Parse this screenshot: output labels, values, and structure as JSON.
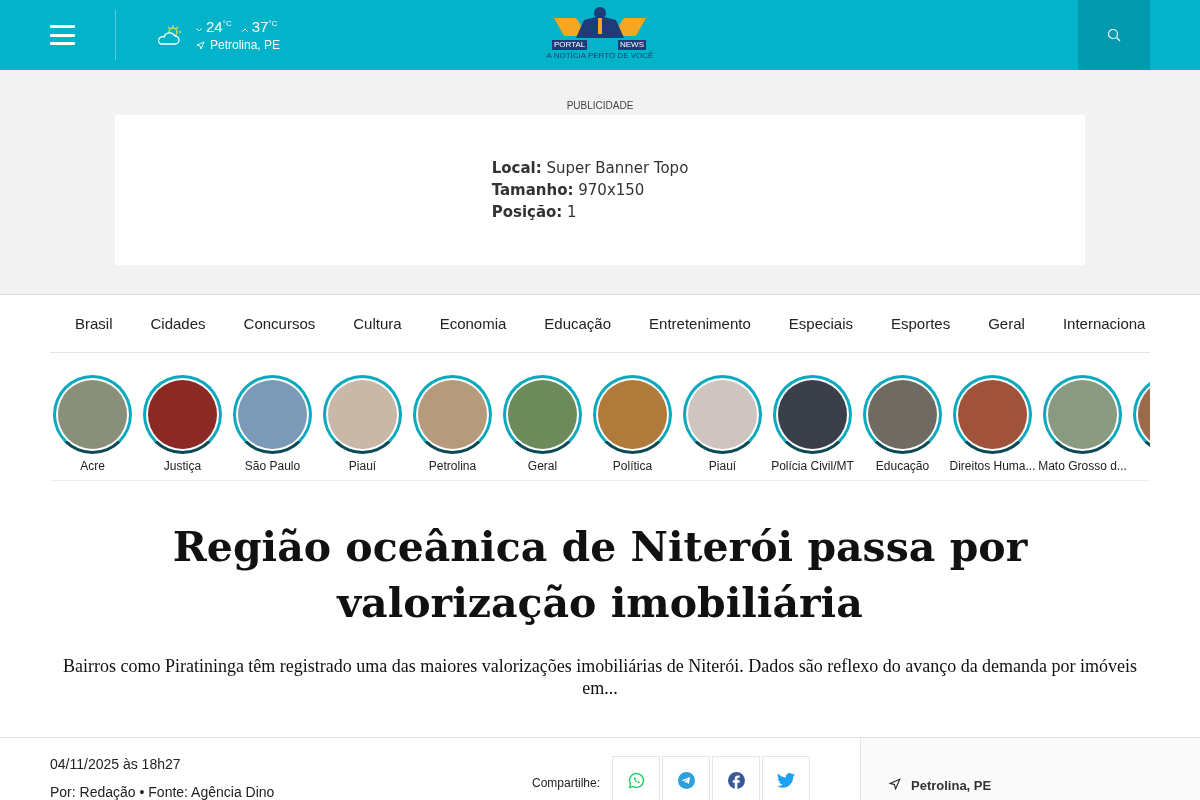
{
  "header": {
    "weather": {
      "min": "24",
      "min_unit": "°C",
      "max": "37",
      "max_unit": "°C",
      "location": "Petrolina, PE"
    },
    "logo": {
      "left": "PORTAL",
      "right": "NEWS",
      "tagline": "A NOTÍCIA PERTO DE VOCÊ"
    }
  },
  "ad": {
    "label": "PUBLICIDADE",
    "lines": [
      {
        "key": "Local:",
        "value": "Super Banner Topo"
      },
      {
        "key": "Tamanho:",
        "value": "970x150"
      },
      {
        "key": "Posição:",
        "value": "1"
      }
    ]
  },
  "categories": [
    "Brasil",
    "Cidades",
    "Concursos",
    "Cultura",
    "Economia",
    "Educação",
    "Entretenimento",
    "Especiais",
    "Esportes",
    "Geral",
    "Internaciona"
  ],
  "stories": [
    "Acre",
    "Justiça",
    "São Paulo",
    "Piauí",
    "Petrolina",
    "Geral",
    "Política",
    "Piauí",
    "Polícia Civil/MT",
    "Educação",
    "Direitos Huma...",
    "Mato Grosso d..."
  ],
  "article": {
    "title": "Região oceânica de Niterói passa por valorização imobiliária",
    "summary": "Bairros como Piratininga têm registrado uma das maiores valorizações imobiliárias de Niterói. Dados são reflexo do avanço da demanda por imóveis em...",
    "date": "04/11/2025 às 18h27",
    "byline": "Por: Redação • Fonte: Agência Dino",
    "share_label": "Compartilhe:",
    "share": [
      {
        "kind": "whatsapp",
        "color": "#25d366"
      },
      {
        "kind": "telegram",
        "color": "#2aa1da"
      },
      {
        "kind": "facebook",
        "color": "#3b5998"
      },
      {
        "kind": "twitter",
        "color": "#1da1f2"
      }
    ]
  },
  "sidebar": {
    "location": "Petrolina, PE"
  }
}
